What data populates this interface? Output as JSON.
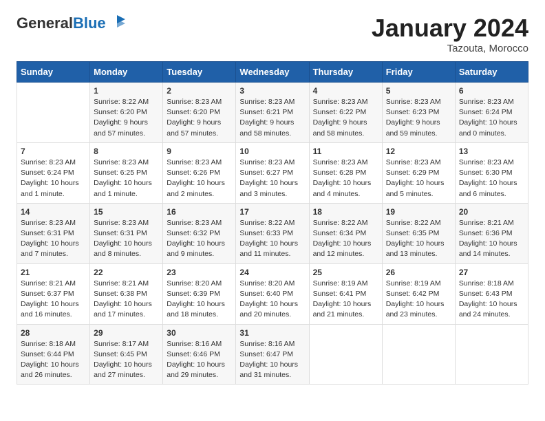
{
  "header": {
    "logo_general": "General",
    "logo_blue": "Blue",
    "month_title": "January 2024",
    "location": "Tazouta, Morocco"
  },
  "weekdays": [
    "Sunday",
    "Monday",
    "Tuesday",
    "Wednesday",
    "Thursday",
    "Friday",
    "Saturday"
  ],
  "weeks": [
    [
      {
        "day": "",
        "info": ""
      },
      {
        "day": "1",
        "info": "Sunrise: 8:22 AM\nSunset: 6:20 PM\nDaylight: 9 hours\nand 57 minutes."
      },
      {
        "day": "2",
        "info": "Sunrise: 8:23 AM\nSunset: 6:20 PM\nDaylight: 9 hours\nand 57 minutes."
      },
      {
        "day": "3",
        "info": "Sunrise: 8:23 AM\nSunset: 6:21 PM\nDaylight: 9 hours\nand 58 minutes."
      },
      {
        "day": "4",
        "info": "Sunrise: 8:23 AM\nSunset: 6:22 PM\nDaylight: 9 hours\nand 58 minutes."
      },
      {
        "day": "5",
        "info": "Sunrise: 8:23 AM\nSunset: 6:23 PM\nDaylight: 9 hours\nand 59 minutes."
      },
      {
        "day": "6",
        "info": "Sunrise: 8:23 AM\nSunset: 6:24 PM\nDaylight: 10 hours\nand 0 minutes."
      }
    ],
    [
      {
        "day": "7",
        "info": "Sunrise: 8:23 AM\nSunset: 6:24 PM\nDaylight: 10 hours\nand 1 minute."
      },
      {
        "day": "8",
        "info": "Sunrise: 8:23 AM\nSunset: 6:25 PM\nDaylight: 10 hours\nand 1 minute."
      },
      {
        "day": "9",
        "info": "Sunrise: 8:23 AM\nSunset: 6:26 PM\nDaylight: 10 hours\nand 2 minutes."
      },
      {
        "day": "10",
        "info": "Sunrise: 8:23 AM\nSunset: 6:27 PM\nDaylight: 10 hours\nand 3 minutes."
      },
      {
        "day": "11",
        "info": "Sunrise: 8:23 AM\nSunset: 6:28 PM\nDaylight: 10 hours\nand 4 minutes."
      },
      {
        "day": "12",
        "info": "Sunrise: 8:23 AM\nSunset: 6:29 PM\nDaylight: 10 hours\nand 5 minutes."
      },
      {
        "day": "13",
        "info": "Sunrise: 8:23 AM\nSunset: 6:30 PM\nDaylight: 10 hours\nand 6 minutes."
      }
    ],
    [
      {
        "day": "14",
        "info": "Sunrise: 8:23 AM\nSunset: 6:31 PM\nDaylight: 10 hours\nand 7 minutes."
      },
      {
        "day": "15",
        "info": "Sunrise: 8:23 AM\nSunset: 6:31 PM\nDaylight: 10 hours\nand 8 minutes."
      },
      {
        "day": "16",
        "info": "Sunrise: 8:23 AM\nSunset: 6:32 PM\nDaylight: 10 hours\nand 9 minutes."
      },
      {
        "day": "17",
        "info": "Sunrise: 8:22 AM\nSunset: 6:33 PM\nDaylight: 10 hours\nand 11 minutes."
      },
      {
        "day": "18",
        "info": "Sunrise: 8:22 AM\nSunset: 6:34 PM\nDaylight: 10 hours\nand 12 minutes."
      },
      {
        "day": "19",
        "info": "Sunrise: 8:22 AM\nSunset: 6:35 PM\nDaylight: 10 hours\nand 13 minutes."
      },
      {
        "day": "20",
        "info": "Sunrise: 8:21 AM\nSunset: 6:36 PM\nDaylight: 10 hours\nand 14 minutes."
      }
    ],
    [
      {
        "day": "21",
        "info": "Sunrise: 8:21 AM\nSunset: 6:37 PM\nDaylight: 10 hours\nand 16 minutes."
      },
      {
        "day": "22",
        "info": "Sunrise: 8:21 AM\nSunset: 6:38 PM\nDaylight: 10 hours\nand 17 minutes."
      },
      {
        "day": "23",
        "info": "Sunrise: 8:20 AM\nSunset: 6:39 PM\nDaylight: 10 hours\nand 18 minutes."
      },
      {
        "day": "24",
        "info": "Sunrise: 8:20 AM\nSunset: 6:40 PM\nDaylight: 10 hours\nand 20 minutes."
      },
      {
        "day": "25",
        "info": "Sunrise: 8:19 AM\nSunset: 6:41 PM\nDaylight: 10 hours\nand 21 minutes."
      },
      {
        "day": "26",
        "info": "Sunrise: 8:19 AM\nSunset: 6:42 PM\nDaylight: 10 hours\nand 23 minutes."
      },
      {
        "day": "27",
        "info": "Sunrise: 8:18 AM\nSunset: 6:43 PM\nDaylight: 10 hours\nand 24 minutes."
      }
    ],
    [
      {
        "day": "28",
        "info": "Sunrise: 8:18 AM\nSunset: 6:44 PM\nDaylight: 10 hours\nand 26 minutes."
      },
      {
        "day": "29",
        "info": "Sunrise: 8:17 AM\nSunset: 6:45 PM\nDaylight: 10 hours\nand 27 minutes."
      },
      {
        "day": "30",
        "info": "Sunrise: 8:16 AM\nSunset: 6:46 PM\nDaylight: 10 hours\nand 29 minutes."
      },
      {
        "day": "31",
        "info": "Sunrise: 8:16 AM\nSunset: 6:47 PM\nDaylight: 10 hours\nand 31 minutes."
      },
      {
        "day": "",
        "info": ""
      },
      {
        "day": "",
        "info": ""
      },
      {
        "day": "",
        "info": ""
      }
    ]
  ]
}
